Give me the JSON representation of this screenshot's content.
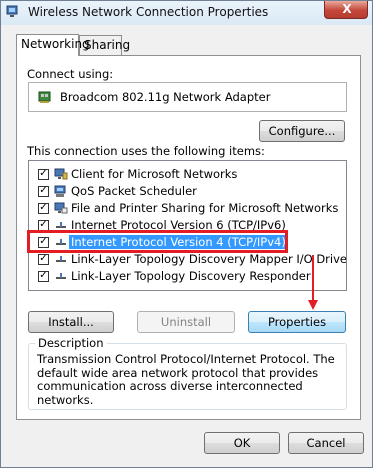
{
  "window": {
    "title": "Wireless Network Connection Properties",
    "close_label": "X"
  },
  "tabs": [
    {
      "label": "Networking"
    },
    {
      "label": "Sharing"
    }
  ],
  "connect": {
    "label": "Connect using:",
    "adapter": "Broadcom 802.11g Network Adapter",
    "configure_label": "Configure..."
  },
  "items_label": "This connection uses the following items:",
  "items": [
    {
      "label": "Client for Microsoft Networks",
      "checked": true,
      "icon": "network-client-icon"
    },
    {
      "label": "QoS Packet Scheduler",
      "checked": true,
      "icon": "qos-scheduler-icon"
    },
    {
      "label": "File and Printer Sharing for Microsoft Networks",
      "checked": true,
      "icon": "file-printer-sharing-icon"
    },
    {
      "label": "Internet Protocol Version 6 (TCP/IPv6)",
      "checked": true,
      "icon": "protocol-icon"
    },
    {
      "label": "Internet Protocol Version 4 (TCP/IPv4)",
      "checked": true,
      "icon": "protocol-icon",
      "selected": true
    },
    {
      "label": "Link-Layer Topology Discovery Mapper I/O Driver",
      "checked": true,
      "icon": "protocol-icon"
    },
    {
      "label": "Link-Layer Topology Discovery Responder",
      "checked": true,
      "icon": "protocol-icon"
    }
  ],
  "buttons": {
    "install": "Install...",
    "uninstall": "Uninstall",
    "properties": "Properties",
    "ok": "OK",
    "cancel": "Cancel"
  },
  "description": {
    "title": "Description",
    "text": "Transmission Control Protocol/Internet Protocol. The default wide area network protocol that provides communication across diverse interconnected networks."
  },
  "colors": {
    "highlight": "#e31d24",
    "selection": "#3399ff"
  }
}
